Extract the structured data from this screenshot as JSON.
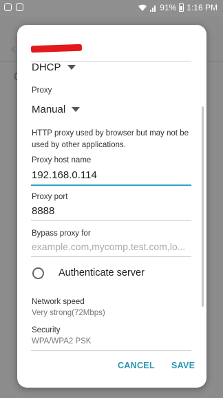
{
  "status_bar": {
    "battery": "91%",
    "time": "1:16 PM",
    "left_icons": [
      "instagram-icon",
      "gallery-icon"
    ],
    "right_icons": [
      "wifi-icon",
      "signal-icon",
      "battery-icon"
    ]
  },
  "background": {
    "letter": "C"
  },
  "dialog": {
    "ip_settings_value": "DHCP",
    "proxy_label": "Proxy",
    "proxy_value": "Manual",
    "proxy_help": "HTTP proxy used by browser but may not be used by other applications.",
    "host_label": "Proxy host name",
    "host_value": "192.168.0.114",
    "port_label": "Proxy port",
    "port_value": "8888",
    "bypass_label": "Bypass proxy for",
    "bypass_placeholder": "example.com,mycomp.test.com,lo...",
    "auth_label": "Authenticate server",
    "network_speed_label": "Network speed",
    "network_speed_value": "Very strong(72Mbps)",
    "security_label": "Security",
    "security_value": "WPA/WPA2 PSK",
    "cancel": "CANCEL",
    "save": "SAVE"
  },
  "colors": {
    "accent": "#2aa7c1",
    "button": "#2a97b0",
    "redaction": "#e3191c"
  }
}
